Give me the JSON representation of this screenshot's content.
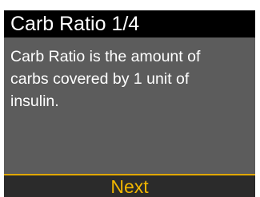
{
  "screen": {
    "title": "Carb Ratio 1/4",
    "body_lines": [
      "Carb Ratio is the amount of",
      "carbs covered by 1 unit of",
      "insulin."
    ],
    "next_label": "Next"
  },
  "colors": {
    "screen_background": "#5c5c5c",
    "title_bar": "#000000",
    "text": "#ffffff",
    "accent": "#f2b600",
    "bottom_bar": "#2b2b2b"
  }
}
